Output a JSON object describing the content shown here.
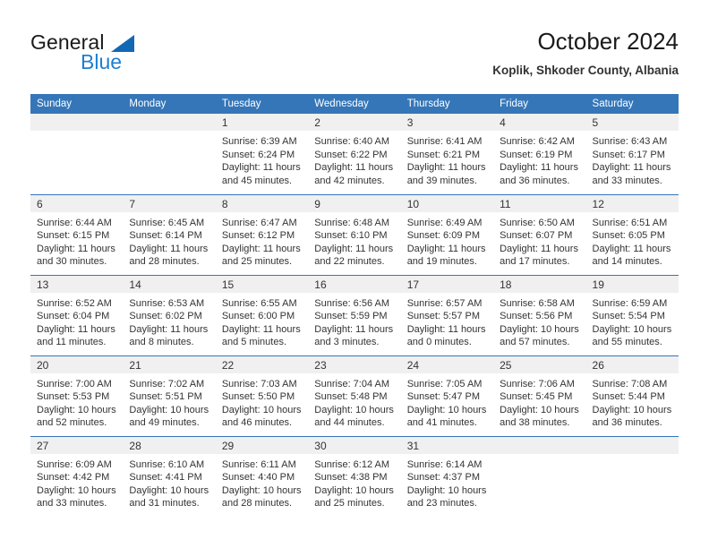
{
  "brand": {
    "name_top": "General",
    "name_bottom": "Blue",
    "triangle_color": "#1268b3",
    "blue_text_color": "#1f7fd0"
  },
  "header": {
    "title": "October 2024",
    "subtitle": "Koplik, Shkoder County, Albania"
  },
  "theme": {
    "header_blue": "#3576b8",
    "daynum_band": "#f0f0f0",
    "text": "#333333"
  },
  "weekdays": [
    "Sunday",
    "Monday",
    "Tuesday",
    "Wednesday",
    "Thursday",
    "Friday",
    "Saturday"
  ],
  "labels": {
    "sunrise_prefix": "Sunrise:",
    "sunset_prefix": "Sunset:",
    "daylight_prefix": "Daylight:"
  },
  "weeks": [
    [
      {
        "day": "",
        "empty": true
      },
      {
        "day": "",
        "empty": true
      },
      {
        "day": "1",
        "sunrise": "Sunrise: 6:39 AM",
        "sunset": "Sunset: 6:24 PM",
        "daylight1": "Daylight: 11 hours",
        "daylight2": "and 45 minutes."
      },
      {
        "day": "2",
        "sunrise": "Sunrise: 6:40 AM",
        "sunset": "Sunset: 6:22 PM",
        "daylight1": "Daylight: 11 hours",
        "daylight2": "and 42 minutes."
      },
      {
        "day": "3",
        "sunrise": "Sunrise: 6:41 AM",
        "sunset": "Sunset: 6:21 PM",
        "daylight1": "Daylight: 11 hours",
        "daylight2": "and 39 minutes."
      },
      {
        "day": "4",
        "sunrise": "Sunrise: 6:42 AM",
        "sunset": "Sunset: 6:19 PM",
        "daylight1": "Daylight: 11 hours",
        "daylight2": "and 36 minutes."
      },
      {
        "day": "5",
        "sunrise": "Sunrise: 6:43 AM",
        "sunset": "Sunset: 6:17 PM",
        "daylight1": "Daylight: 11 hours",
        "daylight2": "and 33 minutes."
      }
    ],
    [
      {
        "day": "6",
        "sunrise": "Sunrise: 6:44 AM",
        "sunset": "Sunset: 6:15 PM",
        "daylight1": "Daylight: 11 hours",
        "daylight2": "and 30 minutes."
      },
      {
        "day": "7",
        "sunrise": "Sunrise: 6:45 AM",
        "sunset": "Sunset: 6:14 PM",
        "daylight1": "Daylight: 11 hours",
        "daylight2": "and 28 minutes."
      },
      {
        "day": "8",
        "sunrise": "Sunrise: 6:47 AM",
        "sunset": "Sunset: 6:12 PM",
        "daylight1": "Daylight: 11 hours",
        "daylight2": "and 25 minutes."
      },
      {
        "day": "9",
        "sunrise": "Sunrise: 6:48 AM",
        "sunset": "Sunset: 6:10 PM",
        "daylight1": "Daylight: 11 hours",
        "daylight2": "and 22 minutes."
      },
      {
        "day": "10",
        "sunrise": "Sunrise: 6:49 AM",
        "sunset": "Sunset: 6:09 PM",
        "daylight1": "Daylight: 11 hours",
        "daylight2": "and 19 minutes."
      },
      {
        "day": "11",
        "sunrise": "Sunrise: 6:50 AM",
        "sunset": "Sunset: 6:07 PM",
        "daylight1": "Daylight: 11 hours",
        "daylight2": "and 17 minutes."
      },
      {
        "day": "12",
        "sunrise": "Sunrise: 6:51 AM",
        "sunset": "Sunset: 6:05 PM",
        "daylight1": "Daylight: 11 hours",
        "daylight2": "and 14 minutes."
      }
    ],
    [
      {
        "day": "13",
        "sunrise": "Sunrise: 6:52 AM",
        "sunset": "Sunset: 6:04 PM",
        "daylight1": "Daylight: 11 hours",
        "daylight2": "and 11 minutes."
      },
      {
        "day": "14",
        "sunrise": "Sunrise: 6:53 AM",
        "sunset": "Sunset: 6:02 PM",
        "daylight1": "Daylight: 11 hours",
        "daylight2": "and 8 minutes."
      },
      {
        "day": "15",
        "sunrise": "Sunrise: 6:55 AM",
        "sunset": "Sunset: 6:00 PM",
        "daylight1": "Daylight: 11 hours",
        "daylight2": "and 5 minutes."
      },
      {
        "day": "16",
        "sunrise": "Sunrise: 6:56 AM",
        "sunset": "Sunset: 5:59 PM",
        "daylight1": "Daylight: 11 hours",
        "daylight2": "and 3 minutes."
      },
      {
        "day": "17",
        "sunrise": "Sunrise: 6:57 AM",
        "sunset": "Sunset: 5:57 PM",
        "daylight1": "Daylight: 11 hours",
        "daylight2": "and 0 minutes."
      },
      {
        "day": "18",
        "sunrise": "Sunrise: 6:58 AM",
        "sunset": "Sunset: 5:56 PM",
        "daylight1": "Daylight: 10 hours",
        "daylight2": "and 57 minutes."
      },
      {
        "day": "19",
        "sunrise": "Sunrise: 6:59 AM",
        "sunset": "Sunset: 5:54 PM",
        "daylight1": "Daylight: 10 hours",
        "daylight2": "and 55 minutes."
      }
    ],
    [
      {
        "day": "20",
        "sunrise": "Sunrise: 7:00 AM",
        "sunset": "Sunset: 5:53 PM",
        "daylight1": "Daylight: 10 hours",
        "daylight2": "and 52 minutes."
      },
      {
        "day": "21",
        "sunrise": "Sunrise: 7:02 AM",
        "sunset": "Sunset: 5:51 PM",
        "daylight1": "Daylight: 10 hours",
        "daylight2": "and 49 minutes."
      },
      {
        "day": "22",
        "sunrise": "Sunrise: 7:03 AM",
        "sunset": "Sunset: 5:50 PM",
        "daylight1": "Daylight: 10 hours",
        "daylight2": "and 46 minutes."
      },
      {
        "day": "23",
        "sunrise": "Sunrise: 7:04 AM",
        "sunset": "Sunset: 5:48 PM",
        "daylight1": "Daylight: 10 hours",
        "daylight2": "and 44 minutes."
      },
      {
        "day": "24",
        "sunrise": "Sunrise: 7:05 AM",
        "sunset": "Sunset: 5:47 PM",
        "daylight1": "Daylight: 10 hours",
        "daylight2": "and 41 minutes."
      },
      {
        "day": "25",
        "sunrise": "Sunrise: 7:06 AM",
        "sunset": "Sunset: 5:45 PM",
        "daylight1": "Daylight: 10 hours",
        "daylight2": "and 38 minutes."
      },
      {
        "day": "26",
        "sunrise": "Sunrise: 7:08 AM",
        "sunset": "Sunset: 5:44 PM",
        "daylight1": "Daylight: 10 hours",
        "daylight2": "and 36 minutes."
      }
    ],
    [
      {
        "day": "27",
        "sunrise": "Sunrise: 6:09 AM",
        "sunset": "Sunset: 4:42 PM",
        "daylight1": "Daylight: 10 hours",
        "daylight2": "and 33 minutes."
      },
      {
        "day": "28",
        "sunrise": "Sunrise: 6:10 AM",
        "sunset": "Sunset: 4:41 PM",
        "daylight1": "Daylight: 10 hours",
        "daylight2": "and 31 minutes."
      },
      {
        "day": "29",
        "sunrise": "Sunrise: 6:11 AM",
        "sunset": "Sunset: 4:40 PM",
        "daylight1": "Daylight: 10 hours",
        "daylight2": "and 28 minutes."
      },
      {
        "day": "30",
        "sunrise": "Sunrise: 6:12 AM",
        "sunset": "Sunset: 4:38 PM",
        "daylight1": "Daylight: 10 hours",
        "daylight2": "and 25 minutes."
      },
      {
        "day": "31",
        "sunrise": "Sunrise: 6:14 AM",
        "sunset": "Sunset: 4:37 PM",
        "daylight1": "Daylight: 10 hours",
        "daylight2": "and 23 minutes."
      },
      {
        "day": "",
        "empty": true
      },
      {
        "day": "",
        "empty": true
      }
    ]
  ]
}
